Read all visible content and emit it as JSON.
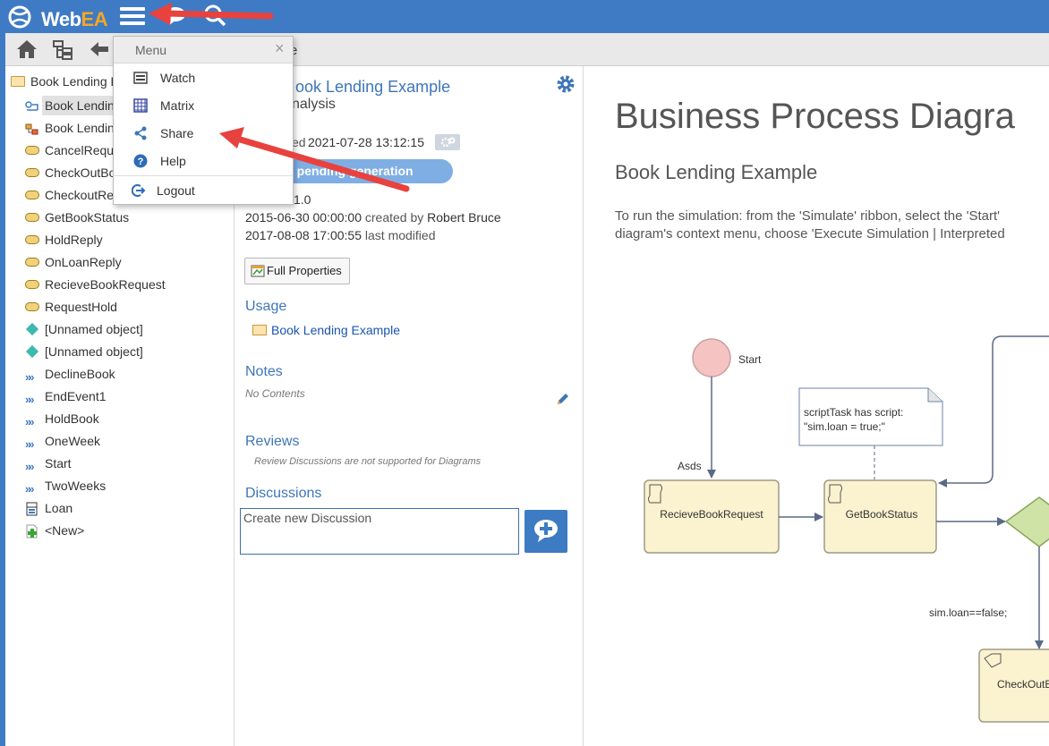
{
  "app": {
    "logo_text_web": "Web",
    "logo_text_ea": "EA"
  },
  "toolbar": {
    "breadcrumb_tail": "e"
  },
  "tree": {
    "items": [
      {
        "label": "Book Lending E",
        "icon": "folder-icon"
      },
      {
        "label": "Book Lending",
        "icon": "bpmn-diagram-icon",
        "selected": true
      },
      {
        "label": "Book Lending",
        "icon": "package-diagram-icon"
      },
      {
        "label": "CancelReque",
        "icon": "message-icon"
      },
      {
        "label": "CheckOutBo",
        "icon": "message-icon"
      },
      {
        "label": "CheckoutRe",
        "icon": "message-icon"
      },
      {
        "label": "GetBookStatus",
        "icon": "message-icon"
      },
      {
        "label": "HoldReply",
        "icon": "message-icon"
      },
      {
        "label": "OnLoanReply",
        "icon": "message-icon"
      },
      {
        "label": "RecieveBookRequest",
        "icon": "message-icon"
      },
      {
        "label": "RequestHold",
        "icon": "message-icon"
      },
      {
        "label": "[Unnamed object]",
        "icon": "diamond-icon"
      },
      {
        "label": "[Unnamed object]",
        "icon": "diamond-icon"
      },
      {
        "label": "DeclineBook",
        "icon": "flow-icon"
      },
      {
        "label": "EndEvent1",
        "icon": "flow-icon"
      },
      {
        "label": "HoldBook",
        "icon": "flow-icon"
      },
      {
        "label": "OneWeek",
        "icon": "flow-icon"
      },
      {
        "label": "Start",
        "icon": "flow-icon"
      },
      {
        "label": "TwoWeeks",
        "icon": "flow-icon"
      },
      {
        "label": "Loan",
        "icon": "class-icon"
      },
      {
        "label": "<New>",
        "icon": "new-icon"
      }
    ]
  },
  "menu": {
    "title": "Menu",
    "close": "×",
    "items": [
      {
        "label": "Watch",
        "icon": "watch-icon"
      },
      {
        "label": "Matrix",
        "icon": "matrix-icon"
      },
      {
        "label": "Share",
        "icon": "share-icon"
      },
      {
        "label": "Help",
        "icon": "help-icon"
      },
      {
        "label": "Logout",
        "icon": "logout-icon"
      }
    ]
  },
  "props": {
    "name": "ook Lending Example",
    "type": "nalysis",
    "modified_label": "ed",
    "modified_value": "2021-07-28 13:12:15",
    "pending_label": "e pending generation",
    "version": "1.0",
    "created_date": "2015-06-30 00:00:00",
    "created_by_label": "created by",
    "created_by": "Robert Bruce",
    "last_modified_date": "2017-08-08 17:00:55",
    "last_modified_label": "last modified",
    "full_properties_label": "Full Properties",
    "usage_heading": "Usage",
    "usage_link": "Book Lending Example",
    "notes_heading": "Notes",
    "notes_value": "No Contents",
    "reviews_heading": "Reviews",
    "reviews_note": "Review Discussions are not supported for Diagrams",
    "discussions_heading": "Discussions",
    "discussion_placeholder": "Create new Discussion"
  },
  "diagram": {
    "title": "Business Process Diagra",
    "subtitle": "Book Lending Example",
    "desc_line1": "To run the simulation:  from the 'Simulate' ribbon, select the 'Start'",
    "desc_line2": "diagram's context menu, choose 'Execute Simulation | Interpreted",
    "start_label": "Start",
    "note_line1": "scriptTask has script:",
    "note_line2": "\"sim.loan = true;\"",
    "edge_label_asds": "Asds",
    "task1": "RecieveBookRequest",
    "task2": "GetBookStatus",
    "cond_label": "sim.loan==false;",
    "task3": "CheckOutB"
  },
  "colors": {
    "topbar": "#3f7bc4",
    "accent_blue": "#3d76b8",
    "annotation_red": "#e8423e",
    "task_fill": "#fbf2cf",
    "start_fill": "#f6c3c3",
    "gateway_fill": "#cfe3a6"
  }
}
